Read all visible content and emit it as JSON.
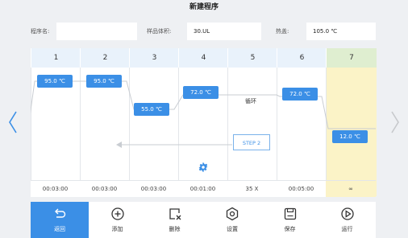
{
  "title": "新建程序",
  "params": {
    "program_name_label": "程序名:",
    "program_name_value": "",
    "sample_volume_label": "样品体积:",
    "sample_volume_value": "30.UL",
    "hot_lid_label": "热盖:",
    "hot_lid_value": "105.0 ℃"
  },
  "steps": {
    "headers": [
      "1",
      "2",
      "3",
      "4",
      "5",
      "6",
      "7"
    ],
    "temps": [
      "95.0 ℃",
      "95.0 ℃",
      "55.0 ℃",
      "72.0 ℃",
      "",
      "72.0 ℃",
      "12.0 ℃"
    ],
    "times": [
      "00:03:00",
      "00:03:00",
      "00:03:00",
      "00:01:00",
      "35 X",
      "00:05:00",
      "∞"
    ],
    "loop_label": "循环",
    "loop_target": "STEP 2"
  },
  "toolbar": {
    "back": "返回",
    "add": "添加",
    "delete": "删除",
    "settings": "设置",
    "save": "保存",
    "run": "运行"
  },
  "icons": {
    "nav_prev": "chevron-left-icon",
    "nav_next": "chevron-right-icon",
    "gear": "gear-icon"
  },
  "colors": {
    "accent": "#3b8fe6",
    "last_step_bg": "#fbf3c7",
    "header_bg": "#e9f2fb"
  }
}
